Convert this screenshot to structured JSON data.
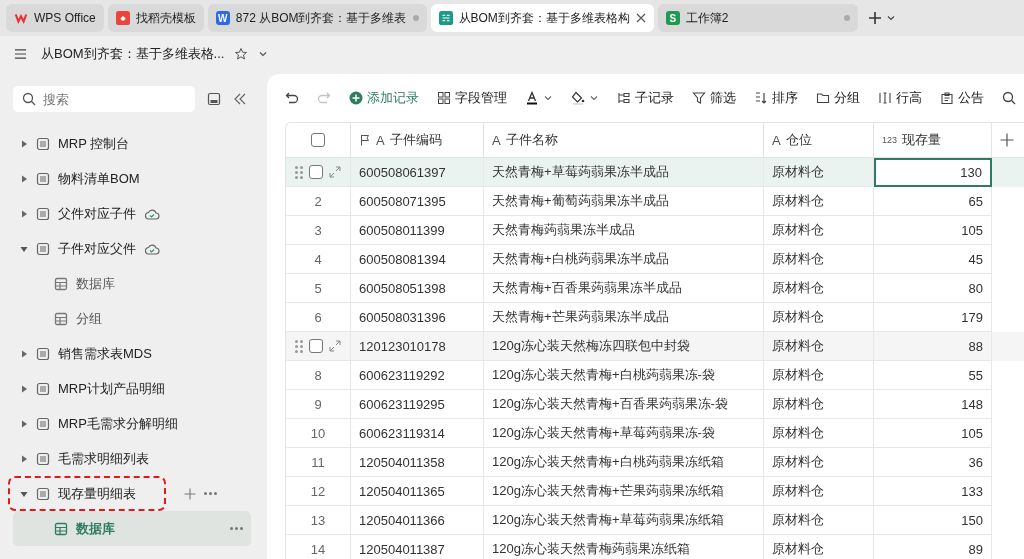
{
  "tabs": [
    {
      "kind": "wps",
      "label": "WPS Office",
      "selected": false,
      "dot": false
    },
    {
      "kind": "template",
      "label": "找稻壳模板",
      "selected": false,
      "dot": false
    },
    {
      "kind": "doc",
      "badge": "W",
      "label": "872 从BOM到齐套：基于多维表",
      "selected": false,
      "dot": true
    },
    {
      "kind": "base",
      "label": "从BOM到齐套：基于多维表格构",
      "selected": true,
      "dot": false
    },
    {
      "kind": "sheet",
      "badge": "S",
      "label": "工作簿2",
      "selected": false,
      "dot": true
    }
  ],
  "title": "从BOM到齐套：基于多维表格...",
  "sidebar": {
    "search_placeholder": "搜索",
    "items": [
      {
        "label": "MRP 控制台",
        "expanded": false,
        "synced": false,
        "highlighted": false
      },
      {
        "label": "物料清单BOM",
        "expanded": false,
        "synced": false,
        "highlighted": false
      },
      {
        "label": "父件对应子件",
        "expanded": false,
        "synced": true,
        "highlighted": false
      },
      {
        "label": "子件对应父件",
        "expanded": true,
        "synced": true,
        "highlighted": false,
        "children": [
          {
            "label": "数据库",
            "selected": false
          },
          {
            "label": "分组",
            "selected": false
          }
        ]
      },
      {
        "label": "销售需求表MDS",
        "expanded": false,
        "synced": false,
        "highlighted": false
      },
      {
        "label": "MRP计划产品明细",
        "expanded": false,
        "synced": false,
        "highlighted": false
      },
      {
        "label": "MRP毛需求分解明细",
        "expanded": false,
        "synced": false,
        "highlighted": false
      },
      {
        "label": "毛需求明细列表",
        "expanded": false,
        "synced": false,
        "highlighted": false
      },
      {
        "label": "现存量明细表",
        "expanded": true,
        "synced": false,
        "highlighted": true,
        "children": [
          {
            "label": "数据库",
            "selected": true
          }
        ]
      }
    ]
  },
  "toolbar": [
    {
      "kind": "undo",
      "disabled": false
    },
    {
      "kind": "redo",
      "disabled": true
    },
    {
      "kind": "add",
      "label": "添加记录"
    },
    {
      "kind": "fields",
      "label": "字段管理"
    },
    {
      "kind": "textcolor"
    },
    {
      "kind": "fill"
    },
    {
      "kind": "subrecord",
      "label": "子记录"
    },
    {
      "kind": "filter",
      "label": "筛选"
    },
    {
      "kind": "sort",
      "label": "排序"
    },
    {
      "kind": "group",
      "label": "分组"
    },
    {
      "kind": "rowheight",
      "label": "行高"
    },
    {
      "kind": "notice",
      "label": "公告"
    },
    {
      "kind": "search"
    }
  ],
  "table": {
    "all_checked": false,
    "columns": [
      {
        "type_label": "A",
        "label": "子件编码",
        "primary": true
      },
      {
        "type_label": "A",
        "label": "子件名称",
        "primary": false
      },
      {
        "type_label": "A",
        "label": "仓位",
        "primary": false
      },
      {
        "type_label": "123",
        "label": "现存量",
        "primary": false
      }
    ],
    "rows": [
      {
        "selected": true,
        "hovered": true,
        "cells": [
          "600508061397",
          "天然青梅+草莓蒟蒻果冻半成品",
          "原材料仓",
          "130"
        ]
      },
      {
        "number": "2",
        "selected": false,
        "hovered": false,
        "cells": [
          "600508071395",
          "天然青梅+葡萄蒟蒻果冻半成品",
          "原材料仓",
          "65"
        ]
      },
      {
        "number": "3",
        "selected": false,
        "hovered": false,
        "cells": [
          "600508011399",
          "天然青梅蒟蒻果冻半成品",
          "原材料仓",
          "105"
        ]
      },
      {
        "number": "4",
        "selected": false,
        "hovered": false,
        "cells": [
          "600508081394",
          "天然青梅+白桃蒟蒻果冻半成品",
          "原材料仓",
          "45"
        ]
      },
      {
        "number": "5",
        "selected": false,
        "hovered": false,
        "cells": [
          "600508051398",
          "天然青梅+百香果蒟蒻果冻半成品",
          "原材料仓",
          "80"
        ]
      },
      {
        "number": "6",
        "selected": false,
        "hovered": false,
        "cells": [
          "600508031396",
          "天然青梅+芒果蒟蒻果冻半成品",
          "原材料仓",
          "179"
        ]
      },
      {
        "selected": false,
        "hovered": true,
        "cells": [
          "120123010178",
          "120g冻心装天然梅冻四联包中封袋",
          "原材料仓",
          "88"
        ]
      },
      {
        "number": "8",
        "selected": false,
        "hovered": false,
        "cells": [
          "600623119292",
          "120g冻心装天然青梅+白桃蒟蒻果冻-袋",
          "原材料仓",
          "55"
        ]
      },
      {
        "number": "9",
        "selected": false,
        "hovered": false,
        "cells": [
          "600623119295",
          "120g冻心装天然青梅+百香果蒟蒻果冻-袋",
          "原材料仓",
          "148"
        ]
      },
      {
        "number": "10",
        "selected": false,
        "hovered": false,
        "cells": [
          "600623119314",
          "120g冻心装天然青梅+草莓蒟蒻果冻-袋",
          "原材料仓",
          "105"
        ]
      },
      {
        "number": "11",
        "selected": false,
        "hovered": false,
        "cells": [
          "120504011358",
          "120g冻心装天然青梅+白桃蒟蒻果冻纸箱",
          "原材料仓",
          "36"
        ]
      },
      {
        "number": "12",
        "selected": false,
        "hovered": false,
        "cells": [
          "120504011365",
          "120g冻心装天然青梅+芒果蒟蒻果冻纸箱",
          "原材料仓",
          "133"
        ]
      },
      {
        "number": "13",
        "selected": false,
        "hovered": false,
        "cells": [
          "120504011366",
          "120g冻心装天然青梅+草莓蒟蒻果冻纸箱",
          "原材料仓",
          "150"
        ]
      },
      {
        "number": "14",
        "selected": false,
        "hovered": false,
        "cells": [
          "120504011387",
          "120g冻心装天然青梅蒟蒻果冻纸箱",
          "原材料仓",
          "89"
        ]
      }
    ]
  }
}
